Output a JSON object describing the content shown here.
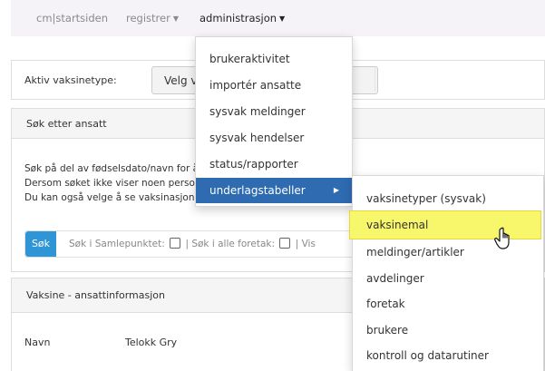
{
  "nav": {
    "brand": "cm|startsiden",
    "registrer": "registrer",
    "administrasjon": "administrasjon"
  },
  "vaccine_bar": {
    "label": "Aktiv vaksinetype:",
    "select_value": "Velg vaksinetype"
  },
  "search_panel": {
    "title": "Søk etter ansatt",
    "lines": [
      "Søk på del av fødselsdato/navn for å finne en ansatt.",
      "Dersom søket ikke viser noen personer, må du velge vaksinetype.",
      "Du kan også velge å se vaksinasjonsstatus."
    ],
    "search_button": "Søk",
    "filter_samlepunktet": "Søk i Samlepunktet:",
    "filter_foretak": "Søk i alle foretak:",
    "filter_vis": "Vis"
  },
  "info_panel": {
    "title": "Vaksine - ansattinformasjon",
    "name_label": "Navn",
    "name_value": "Telokk Gry"
  },
  "admin_menu": {
    "items": [
      "brukeraktivitet",
      "importér ansatte",
      "sysvak meldinger",
      "sysvak hendelser",
      "status/rapporter",
      "underlagstabeller"
    ]
  },
  "submenu": {
    "items": [
      "vaksinetyper (sysvak)",
      "vaksinemal",
      "meldinger/artikler",
      "avdelinger",
      "foretak",
      "brukere",
      "kontroll og datarutiner"
    ]
  },
  "colors": {
    "primary_button": "#2f95d7",
    "menu_selected": "#2e6bb0",
    "highlight": "#f8f66a"
  }
}
